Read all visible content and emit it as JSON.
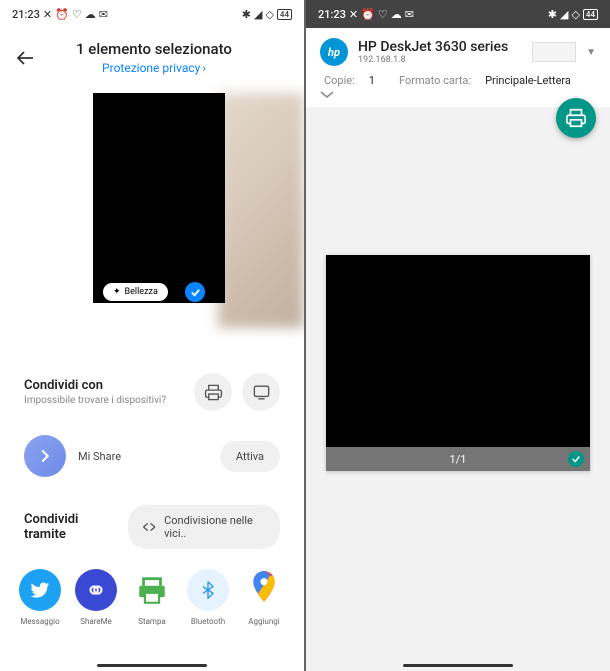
{
  "status": {
    "time": "21:23",
    "battery": "44"
  },
  "share": {
    "title": "1 elemento selezionato",
    "privacy": "Protezione privacy",
    "beauty_chip": "Bellezza",
    "share_with": "Condividi con",
    "share_with_sub": "Impossibile trovare i dispositivi?",
    "mishare": "Mi Share",
    "activate": "Attiva",
    "share_via": "Condividi tramite",
    "nearby": "Condivisione nelle vici..",
    "apps": [
      {
        "label": "Messaggio"
      },
      {
        "label": "ShareMe"
      },
      {
        "label": "Stampa"
      },
      {
        "label": "Bluetooth"
      },
      {
        "label": "Aggiungi"
      }
    ]
  },
  "print": {
    "printer_name": "HP DeskJet 3630 series",
    "printer_ip": "192.168.1.8",
    "copies_label": "Copie:",
    "copies_value": "1",
    "format_label": "Formato carta:",
    "format_value": "Principale-Lettera",
    "page": "1/1"
  }
}
